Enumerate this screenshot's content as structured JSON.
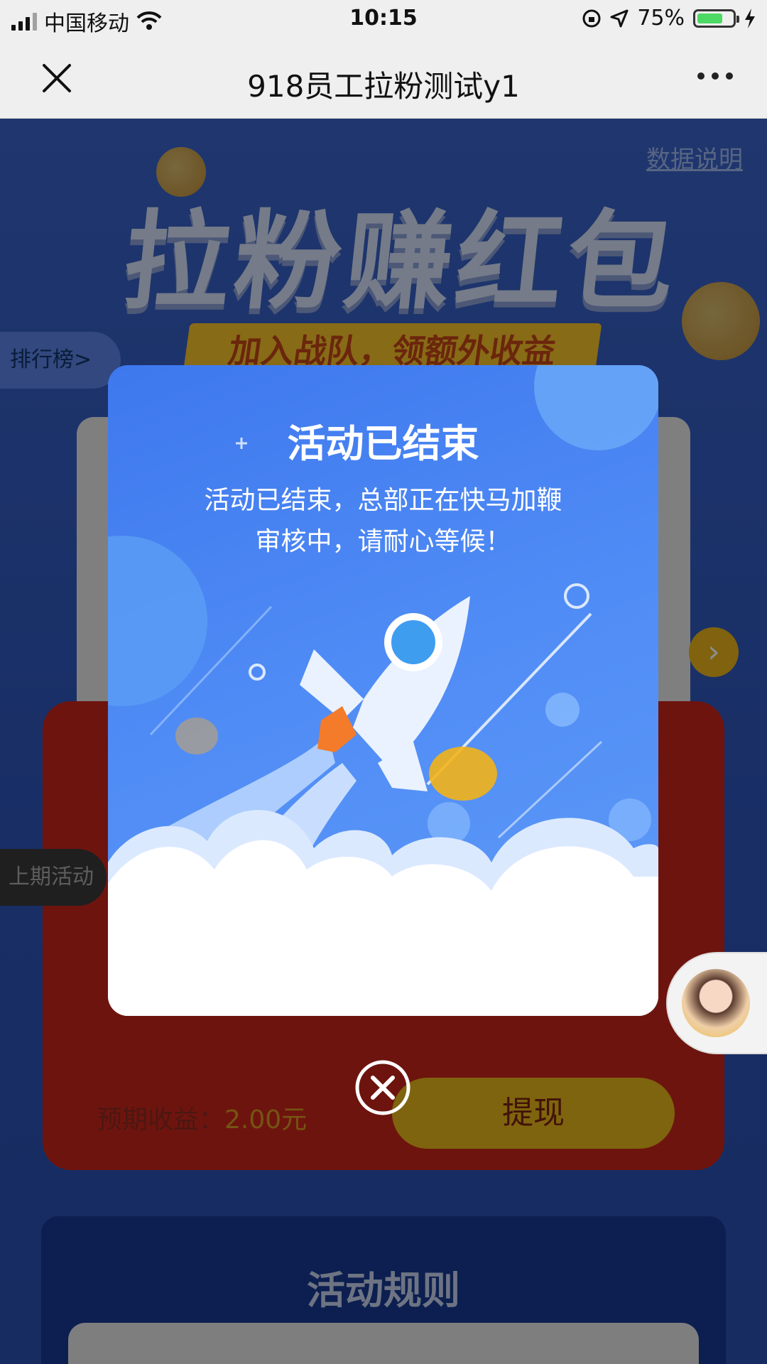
{
  "status_bar": {
    "carrier": "中国移动",
    "time": "10:15",
    "battery": "75%",
    "battery_level": 0.75
  },
  "nav": {
    "title": "918员工拉粉测试y1"
  },
  "background_page": {
    "data_link": "数据说明",
    "hero_title": "拉粉赚红包",
    "hero_banner": "加入战队，领额外收益",
    "rank_tab": "排行榜>",
    "last_activity_tab": "上期活动",
    "expected_label": "预期收益：",
    "expected_amount": "2.00元",
    "withdraw_label": "提现",
    "rules_title": "活动规则"
  },
  "modal": {
    "title": "活动已结束",
    "message": "活动已结束，总部正在快马加鞭审核中，请耐心等候！"
  },
  "colors": {
    "modal_blue": "#4f8bf5",
    "accent_yellow": "#e6b71a",
    "envelope_red": "#c9251b"
  }
}
